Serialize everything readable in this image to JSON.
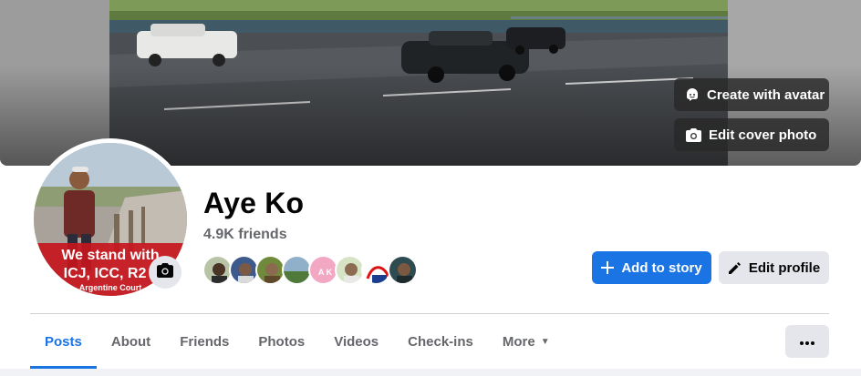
{
  "cover": {
    "avatar_button_label": "Create with avatar",
    "avatar_button_icon": "avatar-face-icon",
    "edit_cover_label": "Edit cover photo",
    "edit_cover_icon": "camera-icon"
  },
  "profile": {
    "name": "Aye Ko",
    "friends_count": "4.9K friends",
    "avatar_overlay_text_line1": "We stand with",
    "avatar_overlay_text_line2": "ICJ, ICC, R2",
    "avatar_overlay_text_line3": "Argentine Court",
    "avatar_camera_icon": "camera-icon",
    "friend_faces_count": 8,
    "friend_face_initials": "A K"
  },
  "actions": {
    "add_to_story": "Add to story",
    "add_to_story_icon": "plus-icon",
    "edit_profile": "Edit profile",
    "edit_profile_icon": "pencil-icon"
  },
  "tabs": [
    {
      "label": "Posts",
      "active": true
    },
    {
      "label": "About",
      "active": false
    },
    {
      "label": "Friends",
      "active": false
    },
    {
      "label": "Photos",
      "active": false
    },
    {
      "label": "Videos",
      "active": false
    },
    {
      "label": "Check-ins",
      "active": false
    },
    {
      "label": "More",
      "active": false
    }
  ],
  "more_button_icon": "ellipsis-icon",
  "colors": {
    "accent": "#1b74e4",
    "secondary_button": "#e4e6eb",
    "muted_text": "#65676b"
  }
}
